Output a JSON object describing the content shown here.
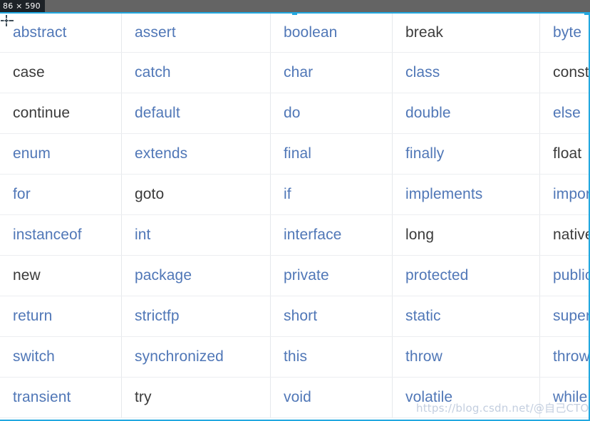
{
  "capture_tool": {
    "size_badge": "86 × 590",
    "cursor_icon": "crosshair-cursor",
    "selection_color": "#22a8e0",
    "topbar_color": "#646464"
  },
  "watermark": {
    "url_text": "https://blog.csdn.net/@自己CTO博客"
  },
  "table": {
    "columns": 5,
    "rows": [
      [
        {
          "text": "abstract",
          "style": "blue"
        },
        {
          "text": "assert",
          "style": "blue"
        },
        {
          "text": "boolean",
          "style": "blue"
        },
        {
          "text": "break",
          "style": "dark"
        },
        {
          "text": "byte",
          "style": "blue"
        }
      ],
      [
        {
          "text": "case",
          "style": "dark"
        },
        {
          "text": "catch",
          "style": "blue"
        },
        {
          "text": "char",
          "style": "blue"
        },
        {
          "text": "class",
          "style": "blue"
        },
        {
          "text": "const",
          "style": "dark"
        }
      ],
      [
        {
          "text": "continue",
          "style": "dark"
        },
        {
          "text": "default",
          "style": "blue"
        },
        {
          "text": "do",
          "style": "blue"
        },
        {
          "text": "double",
          "style": "blue"
        },
        {
          "text": "else",
          "style": "blue"
        }
      ],
      [
        {
          "text": "enum",
          "style": "blue"
        },
        {
          "text": "extends",
          "style": "blue"
        },
        {
          "text": "final",
          "style": "blue"
        },
        {
          "text": "finally",
          "style": "blue"
        },
        {
          "text": "float",
          "style": "dark"
        }
      ],
      [
        {
          "text": "for",
          "style": "blue"
        },
        {
          "text": "goto",
          "style": "dark"
        },
        {
          "text": "if",
          "style": "blue"
        },
        {
          "text": "implements",
          "style": "blue"
        },
        {
          "text": "import",
          "style": "blue"
        }
      ],
      [
        {
          "text": "instanceof",
          "style": "blue"
        },
        {
          "text": "int",
          "style": "blue"
        },
        {
          "text": "interface",
          "style": "blue"
        },
        {
          "text": "long",
          "style": "dark"
        },
        {
          "text": "native",
          "style": "dark"
        }
      ],
      [
        {
          "text": "new",
          "style": "dark"
        },
        {
          "text": "package",
          "style": "blue"
        },
        {
          "text": "private",
          "style": "blue"
        },
        {
          "text": "protected",
          "style": "blue"
        },
        {
          "text": "public",
          "style": "blue"
        }
      ],
      [
        {
          "text": "return",
          "style": "blue"
        },
        {
          "text": "strictfp",
          "style": "blue"
        },
        {
          "text": "short",
          "style": "blue"
        },
        {
          "text": "static",
          "style": "blue"
        },
        {
          "text": "super",
          "style": "blue"
        }
      ],
      [
        {
          "text": "switch",
          "style": "blue"
        },
        {
          "text": "synchronized",
          "style": "blue"
        },
        {
          "text": "this",
          "style": "blue"
        },
        {
          "text": "throw",
          "style": "blue"
        },
        {
          "text": "throws",
          "style": "blue"
        }
      ],
      [
        {
          "text": "transient",
          "style": "blue"
        },
        {
          "text": "try",
          "style": "dark"
        },
        {
          "text": "void",
          "style": "blue"
        },
        {
          "text": "volatile",
          "style": "blue"
        },
        {
          "text": "while",
          "style": "blue"
        }
      ]
    ]
  },
  "colors": {
    "keyword_blue": "#5077b7",
    "keyword_dark": "#3b3b3b",
    "grid_line": "#e6e8ec",
    "selection_blue": "#22a8e0"
  }
}
